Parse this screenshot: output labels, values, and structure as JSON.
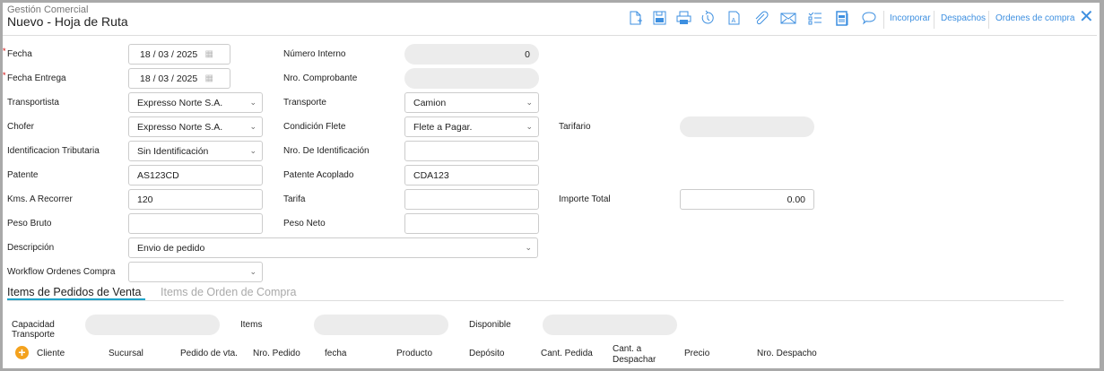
{
  "header": {
    "subtitle": "Gestión Comercial",
    "title": "Nuevo - Hoja de Ruta"
  },
  "toolbar": {
    "icons": [
      "new-document-icon",
      "save-icon",
      "print-icon",
      "history-icon",
      "text-document-icon",
      "attachment-icon",
      "email-icon",
      "checklist-icon",
      "notes-icon",
      "comment-icon"
    ],
    "links": [
      "Incorporar",
      "Despachos",
      "Ordenes de compra"
    ],
    "accent": "#3d8fe0"
  },
  "form": {
    "fields": [
      {
        "label": "Fecha",
        "required": true,
        "col": 0,
        "row": 0,
        "value": "18 / 03 / 2025",
        "type": "date"
      },
      {
        "label": "Número Interno",
        "col": 1,
        "row": 0,
        "value": "0",
        "type": "ro"
      },
      {
        "label": "Fecha Entrega",
        "required": true,
        "col": 0,
        "row": 1,
        "value": "18 / 03 / 2025",
        "type": "date"
      },
      {
        "label": "Nro. Comprobante",
        "col": 1,
        "row": 1,
        "value": "",
        "type": "ro"
      },
      {
        "label": "Transportista",
        "col": 0,
        "row": 2,
        "value": "Expresso Norte S.A.",
        "type": "select"
      },
      {
        "label": "Transporte",
        "col": 1,
        "row": 2,
        "value": "Camion",
        "type": "select"
      },
      {
        "label": "Chofer",
        "col": 0,
        "row": 3,
        "value": "Expresso Norte S.A.",
        "type": "select"
      },
      {
        "label": "Condición Flete",
        "col": 1,
        "row": 3,
        "value": "Flete a Pagar.",
        "type": "select"
      },
      {
        "label": "Tarifario",
        "col": 2,
        "row": 3,
        "value": "",
        "type": "ro"
      },
      {
        "label": "Identificacion Tributaria",
        "col": 0,
        "row": 4,
        "value": "Sin Identificación",
        "type": "select"
      },
      {
        "label": "Nro. De Identificación",
        "col": 1,
        "row": 4,
        "value": "",
        "type": "text"
      },
      {
        "label": "Patente",
        "col": 0,
        "row": 5,
        "value": "AS123CD",
        "type": "text"
      },
      {
        "label": "Patente Acoplado",
        "col": 1,
        "row": 5,
        "value": "CDA123",
        "type": "text"
      },
      {
        "label": "Kms. A Recorrer",
        "col": 0,
        "row": 6,
        "value": "120",
        "type": "text"
      },
      {
        "label": "Tarifa",
        "col": 1,
        "row": 6,
        "value": "",
        "type": "text"
      },
      {
        "label": "Importe Total",
        "col": 2,
        "row": 6,
        "value": "0.00",
        "type": "num"
      },
      {
        "label": "Peso Bruto",
        "col": 0,
        "row": 7,
        "value": "",
        "type": "text"
      },
      {
        "label": "Peso Neto",
        "col": 1,
        "row": 7,
        "value": "",
        "type": "text"
      },
      {
        "label": "Descripción",
        "col": 0,
        "row": 8,
        "value": "Envio de pedido",
        "type": "select",
        "wide": true
      },
      {
        "label": "Workflow Ordenes Compra",
        "col": 0,
        "row": 9,
        "value": "",
        "type": "select"
      }
    ]
  },
  "tabs": [
    {
      "label": "Items de Pedidos de Venta",
      "active": true
    },
    {
      "label": "Items de Orden de Compra",
      "active": false
    }
  ],
  "summary": [
    {
      "label": "Capacidad Transporte",
      "value": ""
    },
    {
      "label": "Items",
      "value": ""
    },
    {
      "label": "Disponible",
      "value": ""
    }
  ],
  "table": {
    "columns": [
      "Cliente",
      "Sucursal",
      "Pedido de vta.",
      "Nro. Pedido",
      "fecha",
      "Producto",
      "Depósito",
      "Cant. Pedida",
      "Cant. a Despachar",
      "Precio",
      "Nro. Despacho"
    ],
    "add_label": "+"
  }
}
